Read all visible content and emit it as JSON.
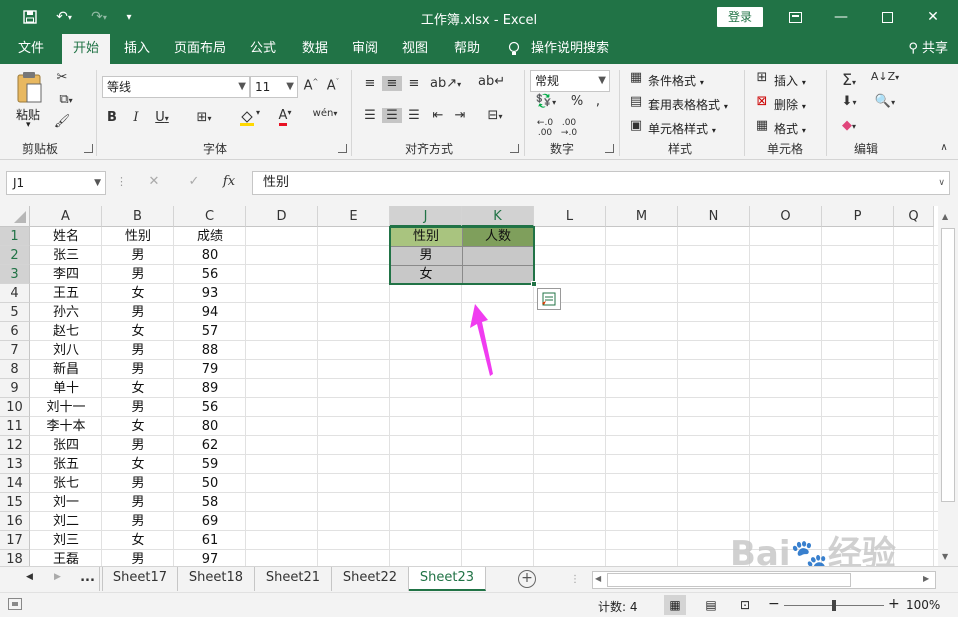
{
  "window": {
    "title": "工作簿.xlsx  -  Excel",
    "login": "登录"
  },
  "tabs": [
    "文件",
    "开始",
    "插入",
    "页面布局",
    "公式",
    "数据",
    "审阅",
    "视图",
    "帮助"
  ],
  "tell_me": "操作说明搜索",
  "share": "共享",
  "ribbon": {
    "clipboard": {
      "paste": "粘贴",
      "label": "剪贴板"
    },
    "font": {
      "name": "等线",
      "size": "11",
      "label": "字体"
    },
    "alignment": {
      "label": "对齐方式"
    },
    "number": {
      "format": "常规",
      "label": "数字"
    },
    "styles": {
      "cond_format": "条件格式",
      "table_format": "套用表格格式",
      "cell_style": "单元格样式",
      "label": "样式"
    },
    "cells": {
      "insert": "插入",
      "delete": "删除",
      "format": "格式",
      "label": "单元格"
    },
    "editing": {
      "label": "编辑"
    }
  },
  "formula_bar": {
    "name_box": "J1",
    "fx": "fx",
    "value": "性别"
  },
  "columns": [
    "A",
    "B",
    "C",
    "D",
    "E",
    "J",
    "K",
    "L",
    "M",
    "N",
    "O",
    "P",
    "Q"
  ],
  "rows": [
    "1",
    "2",
    "3",
    "4",
    "5",
    "6",
    "7",
    "8",
    "9",
    "10",
    "11",
    "12",
    "13",
    "14",
    "15",
    "16",
    "17",
    "18"
  ],
  "data_table": [
    [
      "姓名",
      "性别",
      "成绩"
    ],
    [
      "张三",
      "男",
      "80"
    ],
    [
      "李四",
      "男",
      "56"
    ],
    [
      "王五",
      "女",
      "93"
    ],
    [
      "孙六",
      "男",
      "94"
    ],
    [
      "赵七",
      "女",
      "57"
    ],
    [
      "刘八",
      "男",
      "88"
    ],
    [
      "新昌",
      "男",
      "79"
    ],
    [
      "单十",
      "女",
      "89"
    ],
    [
      "刘十一",
      "男",
      "56"
    ],
    [
      "李十本",
      "女",
      "80"
    ],
    [
      "张四",
      "男",
      "62"
    ],
    [
      "张五",
      "女",
      "59"
    ],
    [
      "张七",
      "男",
      "50"
    ],
    [
      "刘一",
      "男",
      "58"
    ],
    [
      "刘二",
      "男",
      "69"
    ],
    [
      "刘三",
      "女",
      "61"
    ],
    [
      "王磊",
      "男",
      "97"
    ]
  ],
  "summary_table": {
    "headers": [
      "性别",
      "人数"
    ],
    "rows": [
      [
        "男",
        ""
      ],
      [
        "女",
        ""
      ]
    ]
  },
  "sheets": [
    "...",
    "Sheet17",
    "Sheet18",
    "Sheet21",
    "Sheet22",
    "Sheet23"
  ],
  "active_sheet": "Sheet23",
  "status": {
    "count": "计数: 4",
    "zoom": "100%"
  },
  "colors": {
    "excel_green": "#217346",
    "header_light_green": "#a9c47f",
    "header_dark_green": "#7f9f5c",
    "selection_grey": "#c8c8c8",
    "arrow_magenta": "#f03cf0"
  }
}
